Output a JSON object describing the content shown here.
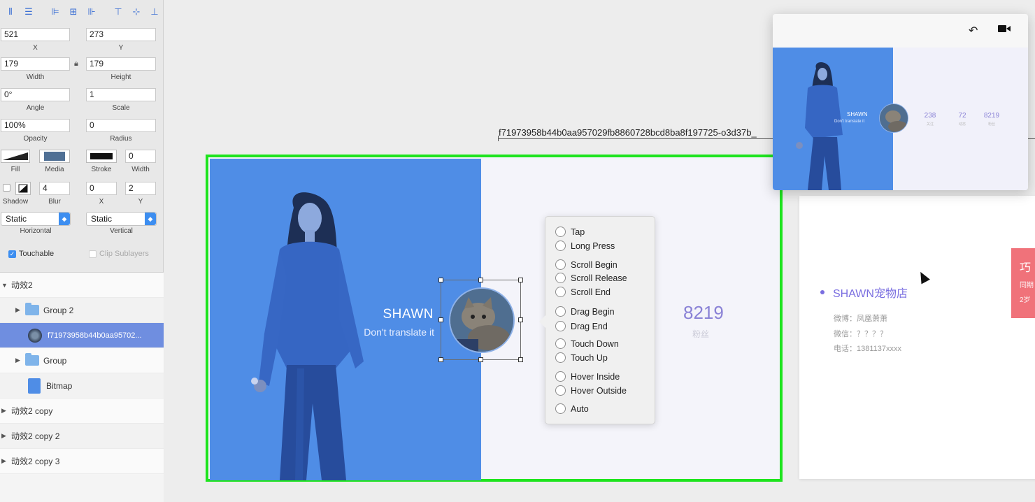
{
  "inspector": {
    "x": "521",
    "x_label": "X",
    "y": "273",
    "y_label": "Y",
    "width": "179",
    "width_label": "Width",
    "height": "179",
    "height_label": "Height",
    "angle": "0°",
    "angle_label": "Angle",
    "scale": "1",
    "scale_label": "Scale",
    "opacity": "100%",
    "opacity_label": "Opacity",
    "radius": "0",
    "radius_label": "Radius",
    "fill_label": "Fill",
    "media_label": "Media",
    "stroke_label": "Stroke",
    "stroke_width": "0",
    "stroke_width_label": "Width",
    "shadow_label": "Shadow",
    "blur": "4",
    "blur_label": "Blur",
    "shadow_x": "0",
    "shadow_x_label": "X",
    "shadow_y": "2",
    "shadow_y_label": "Y",
    "horizontal": "Static",
    "horizontal_label": "Horizontal",
    "vertical": "Static",
    "vertical_label": "Vertical",
    "touchable_label": "Touchable",
    "clip_label": "Clip Sublayers",
    "accent_color": "#3d8ef0"
  },
  "layers": [
    {
      "label": "动效2",
      "kind": "group-open"
    },
    {
      "label": "Group 2",
      "kind": "folder"
    },
    {
      "label": "f71973958b44b0aa95702...",
      "kind": "image",
      "selected": true
    },
    {
      "label": "Group",
      "kind": "folder"
    },
    {
      "label": "Bitmap",
      "kind": "bitmap"
    },
    {
      "label": "动效2 copy",
      "kind": "group"
    },
    {
      "label": "动效2 copy 2",
      "kind": "group"
    },
    {
      "label": "动效2 copy 3",
      "kind": "group"
    }
  ],
  "canvas": {
    "layer_path_label": "f71973958b44b0aa957029fb8860728bcd8ba8f197725-o3d37b_",
    "profile_name": "SHAWN",
    "profile_subtitle": "Don't translate it",
    "stat_value": "8219",
    "stat_label": "粉丝",
    "selection_color": "#1ee41e",
    "panel_color": "#4f8de6"
  },
  "event_menu": {
    "options": [
      "Tap",
      "Long Press",
      "Scroll Begin",
      "Scroll Release",
      "Scroll End",
      "Drag Begin",
      "Drag End",
      "Touch Down",
      "Touch Up",
      "Hover Inside",
      "Hover Outside",
      "Auto"
    ]
  },
  "shop_card": {
    "title": "SHAWN宠物店",
    "weibo": "微博：凤凰萧萧",
    "wechat": "微信：？？？？",
    "phone": "电话：1381137xxxx"
  },
  "red_card": {
    "title": "巧",
    "line1": "同期",
    "line2": "2岁"
  },
  "preview_window": {
    "back_icon": "undo-icon",
    "record_icon": "video-camera-icon",
    "name": "SHAWN",
    "subtitle": "Don't translate it",
    "stats": [
      {
        "value": "238",
        "label": "关注"
      },
      {
        "value": "72",
        "label": "动态"
      },
      {
        "value": "8219",
        "label": "粉丝"
      }
    ]
  }
}
